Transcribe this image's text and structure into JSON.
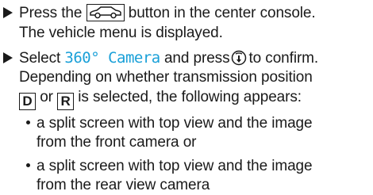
{
  "step1": {
    "part1": "Press the",
    "part2": "button in the center console.",
    "part3": "The vehicle menu is displayed.",
    "car_button_icon": "car-icon"
  },
  "step2": {
    "part1": "Select",
    "menu_term": "360° Camera",
    "part2": "and press",
    "part3": "to confirm.",
    "controller_icon": "controller-press-icon",
    "line2": "Depending on whether transmission position",
    "gear_d": "D",
    "mid": "or",
    "gear_r": "R",
    "line3_end": "is selected, the following appears:"
  },
  "bullets": [
    {
      "line1": "a split screen with top view and the image",
      "line2": "from the front camera or"
    },
    {
      "line1": "a split screen with top view and the image",
      "line2": "from the rear view camera"
    }
  ],
  "colors": {
    "menu_term": "#1aa0d8",
    "text": "#1a1a1a"
  }
}
